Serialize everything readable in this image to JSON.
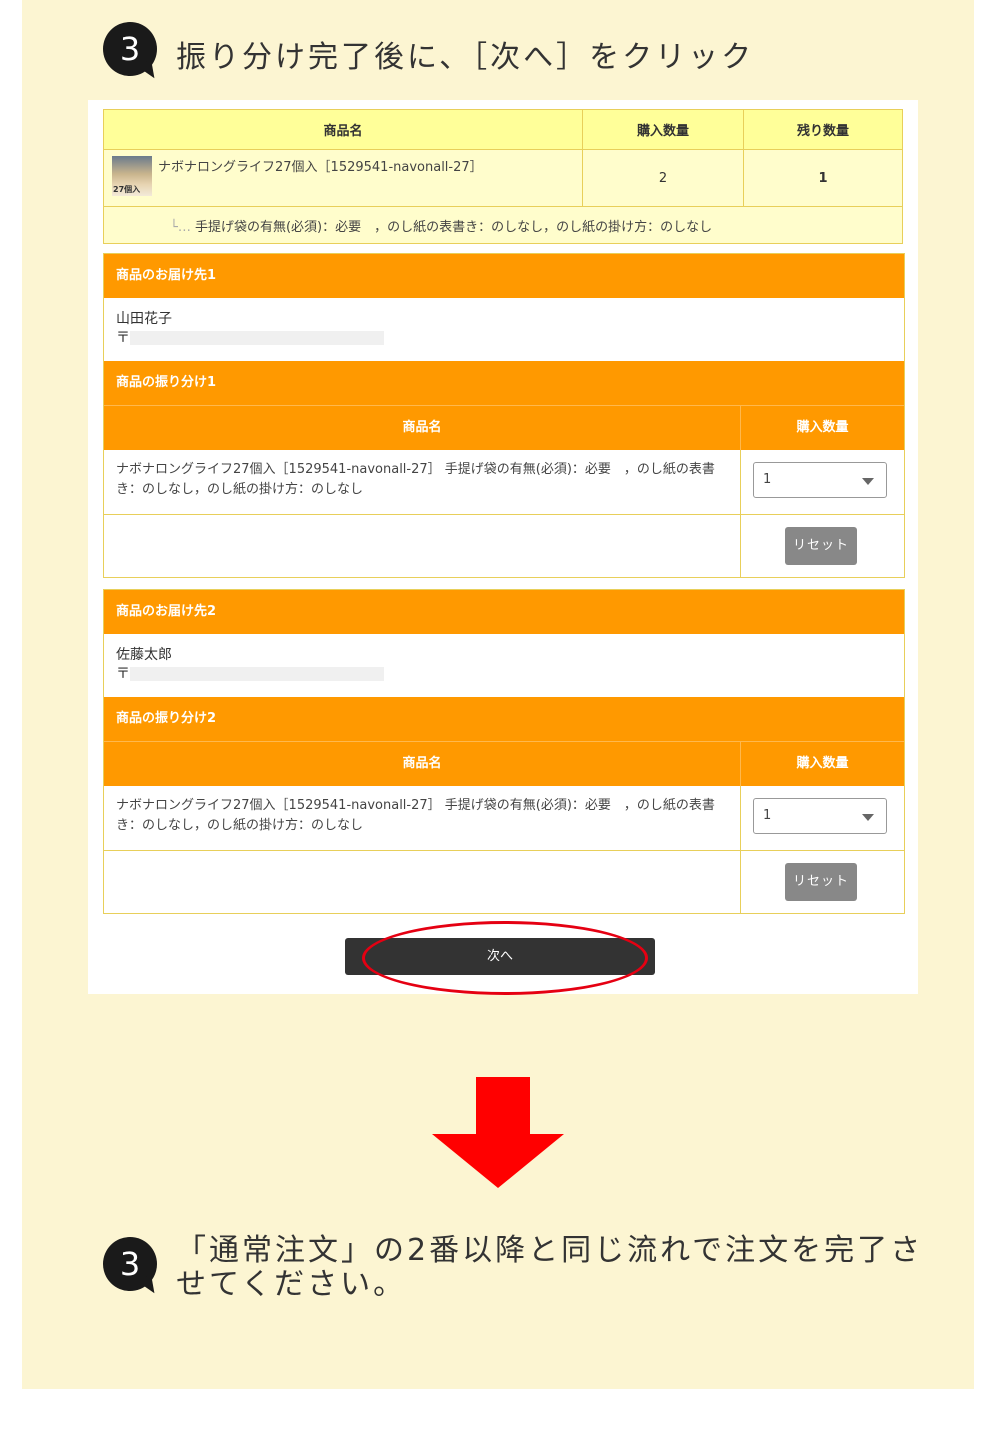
{
  "step1": {
    "number": "3",
    "text": "振り分け完了後に、［次へ］をクリック"
  },
  "summary_table": {
    "headers": [
      "商品名",
      "購入数量",
      "残り数量"
    ],
    "product_name": "ナボナロングライフ27個入［1529541-navonall-27］",
    "thumb_label": "27個入",
    "purchase_qty": "2",
    "remaining_qty": "1",
    "options": "手提げ袋の有無(必須)：必要　，のし紙の表書き：のしなし，のし紙の掛け方：のしなし"
  },
  "shipments": [
    {
      "dest_title": "商品のお届け先1",
      "name": "山田花子",
      "postal_mark": "〒",
      "split_title": "商品の振り分け1",
      "col_product": "商品名",
      "col_qty": "購入数量",
      "product_text": "ナボナロングライフ27個入［1529541-navonall-27］ 手提げ袋の有無(必須)：必要　，のし紙の表書き：のしなし，のし紙の掛け方：のしなし",
      "qty_selected": "1",
      "reset_label": "リセット"
    },
    {
      "dest_title": "商品のお届け先2",
      "name": "佐藤太郎",
      "postal_mark": "〒",
      "split_title": "商品の振り分け2",
      "col_product": "商品名",
      "col_qty": "購入数量",
      "product_text": "ナボナロングライフ27個入［1529541-navonall-27］ 手提げ袋の有無(必須)：必要　，のし紙の表書き：のしなし，のし紙の掛け方：のしなし",
      "qty_selected": "1",
      "reset_label": "リセット"
    }
  ],
  "next_button": "次へ",
  "step2": {
    "number": "3",
    "text_line1": "「通常注文」の2番以降と同じ流れで注文を完了さ",
    "text_line2": "せてください。"
  },
  "colors": {
    "panel_bg": "#fcf5d2",
    "orange": "#ff9900",
    "highlight_red": "#e50012",
    "arrow_red": "#ff0000"
  }
}
